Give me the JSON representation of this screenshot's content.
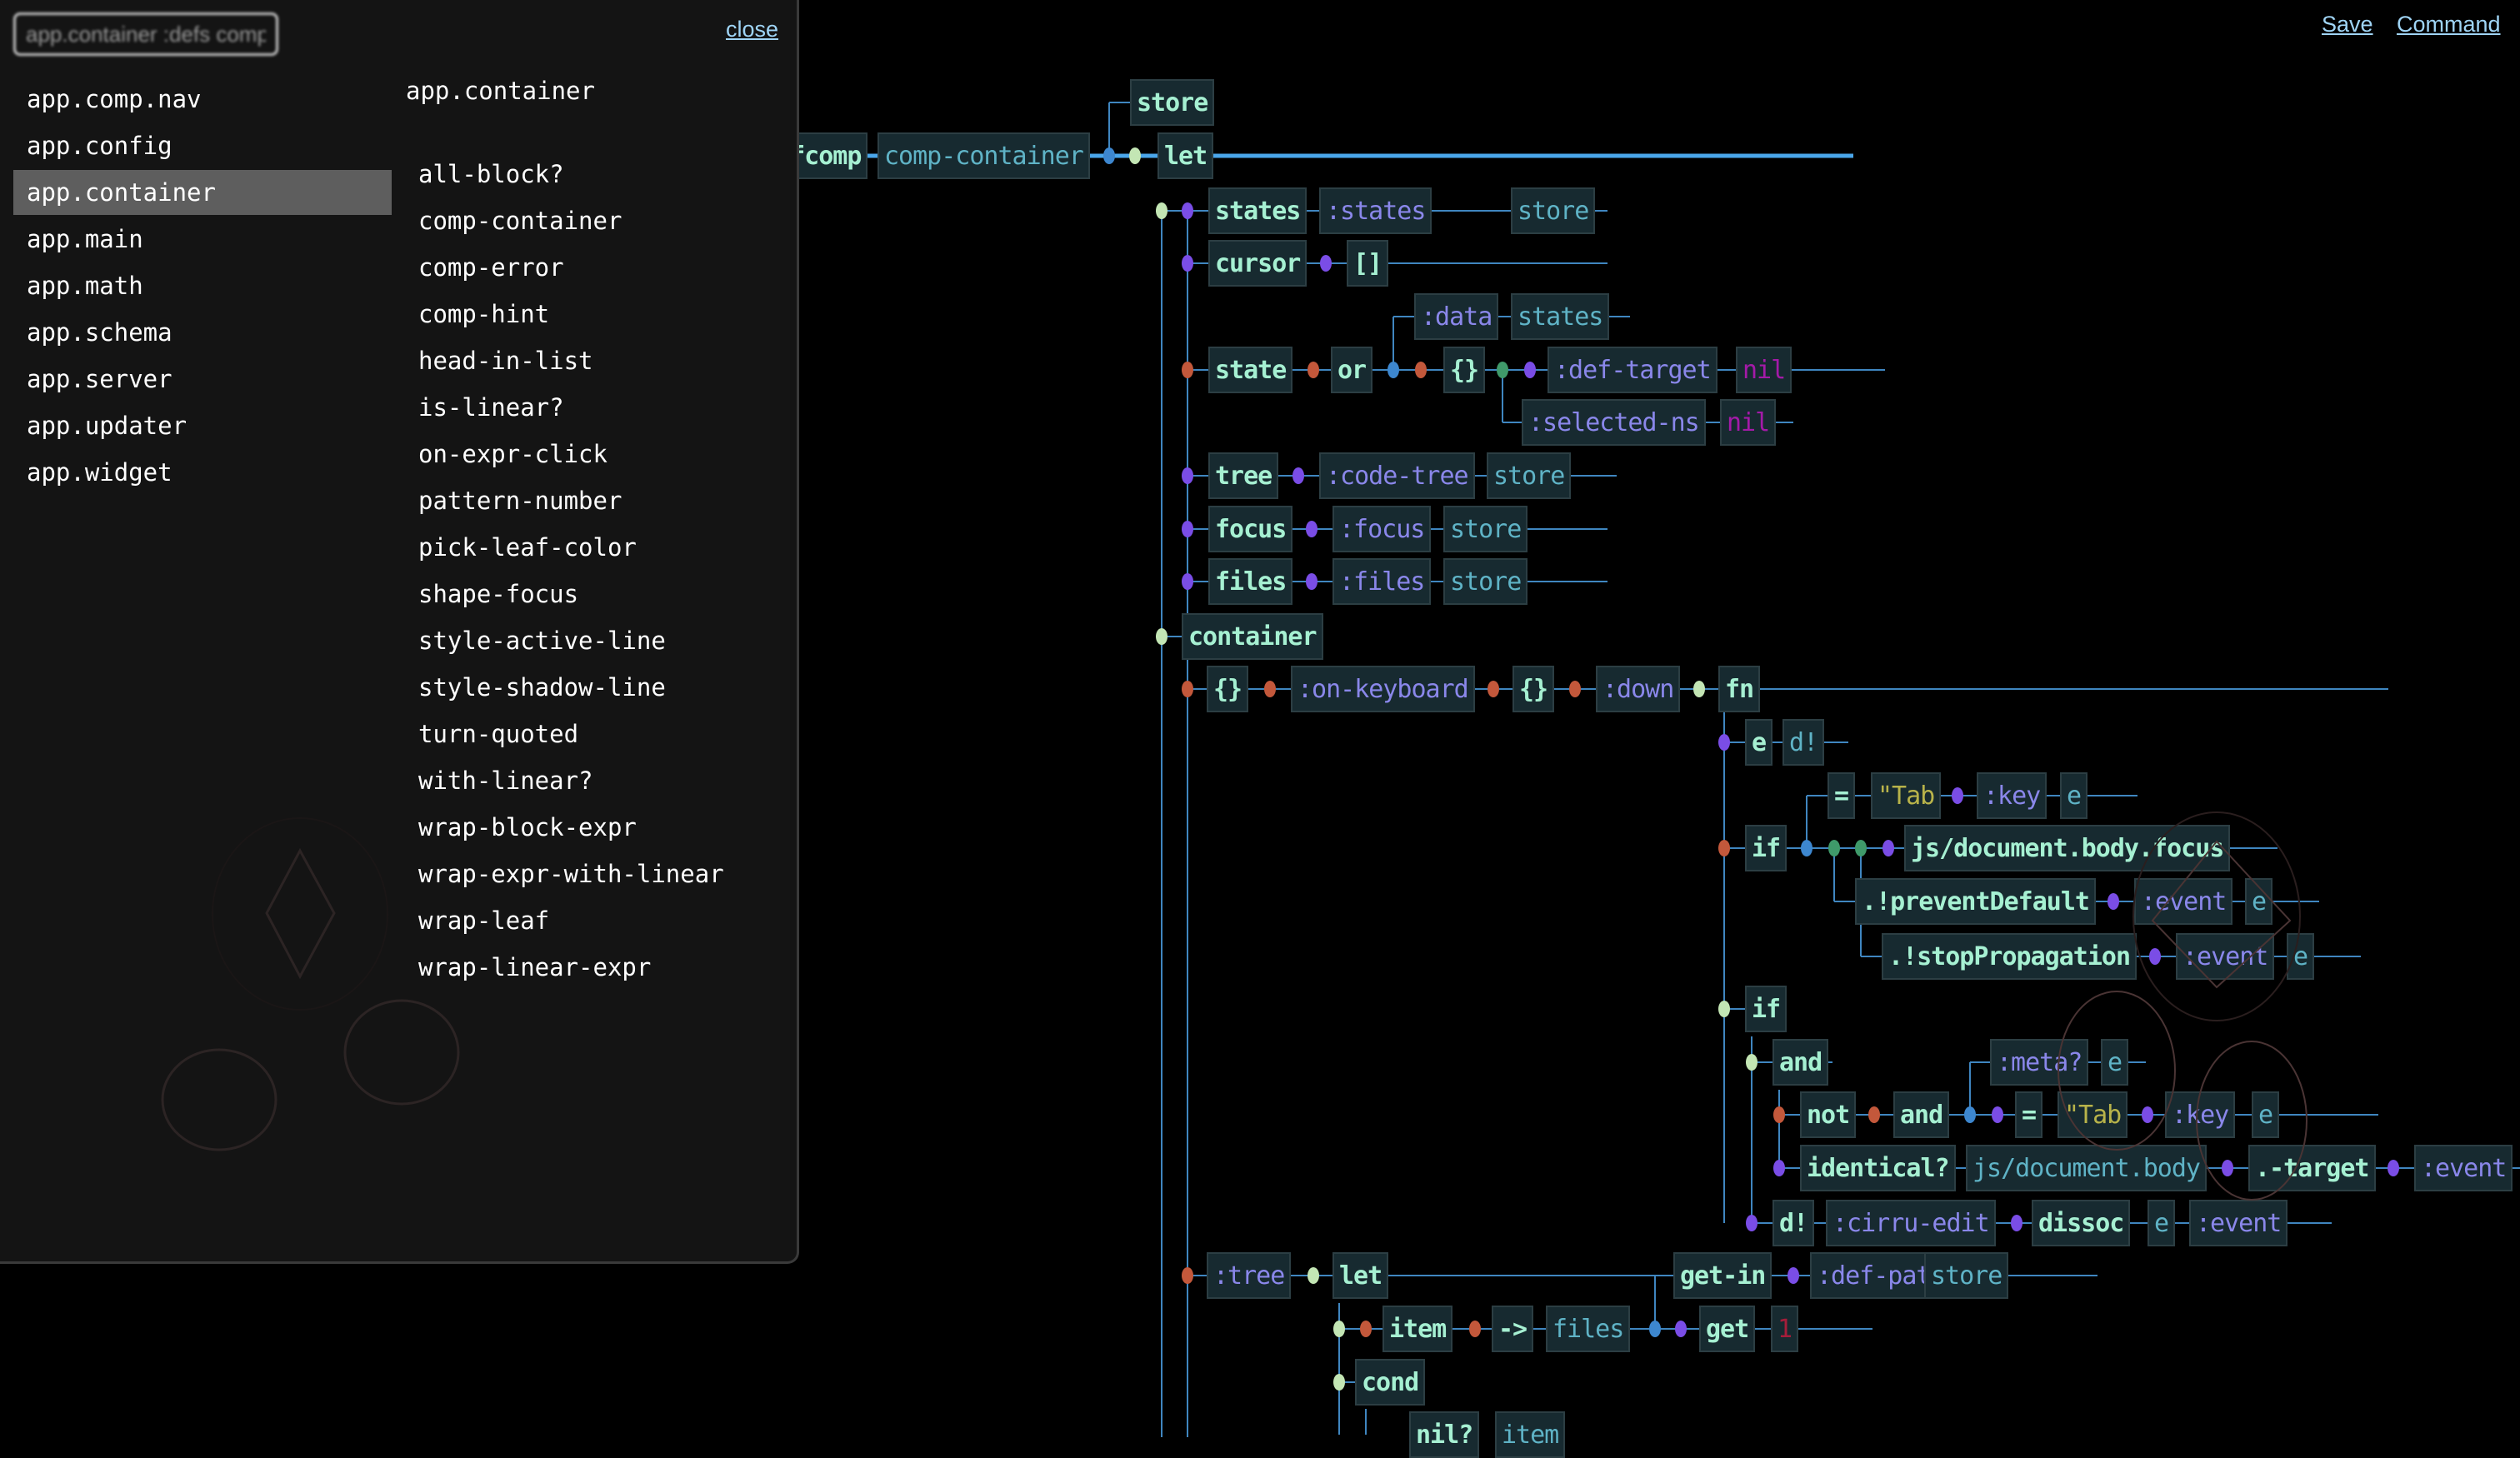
{
  "topbar": {
    "save_label": "Save",
    "command_label": "Command"
  },
  "popup": {
    "search_value": "app.container :defs comp-container",
    "close_label": "close",
    "namespaces": [
      {
        "label": "app.comp.nav",
        "active": false
      },
      {
        "label": "app.config",
        "active": false
      },
      {
        "label": "app.container",
        "active": true
      },
      {
        "label": "app.main",
        "active": false
      },
      {
        "label": "app.math",
        "active": false
      },
      {
        "label": "app.schema",
        "active": false
      },
      {
        "label": "app.server",
        "active": false
      },
      {
        "label": "app.updater",
        "active": false
      },
      {
        "label": "app.widget",
        "active": false
      }
    ],
    "selected_ns_title": "app.container",
    "defs": [
      "all-block?",
      "comp-container",
      "comp-error",
      "comp-hint",
      "head-in-list",
      "is-linear?",
      "on-expr-click",
      "pattern-number",
      "pick-leaf-color",
      "shape-focus",
      "style-active-line",
      "style-shadow-line",
      "turn-quoted",
      "with-linear?",
      "wrap-block-expr",
      "wrap-expr-with-linear",
      "wrap-leaf",
      "wrap-linear-expr"
    ]
  },
  "editor": {
    "colors": {
      "head": "#a6f0d2",
      "keyword": "#8a87ea",
      "symbol": "#5fb3c6",
      "nil": "#a41aa8",
      "string": "#b8b34a",
      "number": "#a51d3a",
      "dot_light": "#c3e6b4",
      "dot_purple": "#7a4de6",
      "dot_red": "#c3583b",
      "dot_blue": "#3d87cf",
      "dot_green": "#3f9a6a"
    },
    "nodes": [
      {
        "text": "defcomp",
        "kind": "head"
      },
      {
        "text": "comp-container",
        "kind": "sym"
      },
      {
        "text": "store",
        "kind": "head"
      },
      {
        "text": "let",
        "kind": "head"
      },
      {
        "text": "states",
        "kind": "head"
      },
      {
        "text": ":states",
        "kind": "kw"
      },
      {
        "text": "store",
        "kind": "sym"
      },
      {
        "text": "cursor",
        "kind": "head"
      },
      {
        "text": "[]",
        "kind": "head"
      },
      {
        "text": ":data",
        "kind": "kw"
      },
      {
        "text": "states",
        "kind": "sym"
      },
      {
        "text": "state",
        "kind": "head"
      },
      {
        "text": "or",
        "kind": "head"
      },
      {
        "text": "{}",
        "kind": "head"
      },
      {
        "text": ":def-target",
        "kind": "kw"
      },
      {
        "text": "nil",
        "kind": "nil"
      },
      {
        "text": ":selected-ns",
        "kind": "kw"
      },
      {
        "text": "nil",
        "kind": "nil"
      },
      {
        "text": "tree",
        "kind": "head"
      },
      {
        "text": ":code-tree",
        "kind": "kw"
      },
      {
        "text": "store",
        "kind": "sym"
      },
      {
        "text": "focus",
        "kind": "head"
      },
      {
        "text": ":focus",
        "kind": "kw"
      },
      {
        "text": "store",
        "kind": "sym"
      },
      {
        "text": "files",
        "kind": "head"
      },
      {
        "text": ":files",
        "kind": "kw"
      },
      {
        "text": "store",
        "kind": "sym"
      },
      {
        "text": "container",
        "kind": "head"
      },
      {
        "text": "{}",
        "kind": "head"
      },
      {
        "text": ":on-keyboard",
        "kind": "kw"
      },
      {
        "text": "{}",
        "kind": "head"
      },
      {
        "text": ":down",
        "kind": "kw"
      },
      {
        "text": "fn",
        "kind": "head"
      },
      {
        "text": "e",
        "kind": "head"
      },
      {
        "text": "d!",
        "kind": "sym"
      },
      {
        "text": "=",
        "kind": "head"
      },
      {
        "text": "\"Tab",
        "kind": "str"
      },
      {
        "text": ":key",
        "kind": "kw"
      },
      {
        "text": "e",
        "kind": "sym"
      },
      {
        "text": "if",
        "kind": "head"
      },
      {
        "text": "js/document.body.focus",
        "kind": "head"
      },
      {
        "text": ".!preventDefault",
        "kind": "head"
      },
      {
        "text": ":event",
        "kind": "kw"
      },
      {
        "text": "e",
        "kind": "sym"
      },
      {
        "text": ".!stopPropagation",
        "kind": "head"
      },
      {
        "text": ":event",
        "kind": "kw"
      },
      {
        "text": "e",
        "kind": "sym"
      },
      {
        "text": "if",
        "kind": "head"
      },
      {
        "text": "and",
        "kind": "head"
      },
      {
        "text": ":meta?",
        "kind": "kw"
      },
      {
        "text": "e",
        "kind": "sym"
      },
      {
        "text": "not",
        "kind": "head"
      },
      {
        "text": "and",
        "kind": "head"
      },
      {
        "text": "=",
        "kind": "head"
      },
      {
        "text": "\"Tab",
        "kind": "str"
      },
      {
        "text": ":key",
        "kind": "kw"
      },
      {
        "text": "e",
        "kind": "sym"
      },
      {
        "text": "identical?",
        "kind": "head"
      },
      {
        "text": "js/document.body",
        "kind": "sym"
      },
      {
        "text": ".-target",
        "kind": "head"
      },
      {
        "text": ":event",
        "kind": "kw"
      },
      {
        "text": "d!",
        "kind": "head"
      },
      {
        "text": ":cirru-edit",
        "kind": "kw"
      },
      {
        "text": "dissoc",
        "kind": "head"
      },
      {
        "text": "e",
        "kind": "sym"
      },
      {
        "text": ":event",
        "kind": "kw"
      },
      {
        "text": ":tree",
        "kind": "kw"
      },
      {
        "text": "let",
        "kind": "head"
      },
      {
        "text": "get-in",
        "kind": "head"
      },
      {
        "text": ":def-path",
        "kind": "kw"
      },
      {
        "text": "store",
        "kind": "sym"
      },
      {
        "text": "item",
        "kind": "head"
      },
      {
        "text": "->",
        "kind": "head"
      },
      {
        "text": "files",
        "kind": "sym"
      },
      {
        "text": "get",
        "kind": "head"
      },
      {
        "text": "1",
        "kind": "num"
      },
      {
        "text": "cond",
        "kind": "head"
      },
      {
        "text": "nil?",
        "kind": "head"
      },
      {
        "text": "item",
        "kind": "sym"
      }
    ]
  }
}
